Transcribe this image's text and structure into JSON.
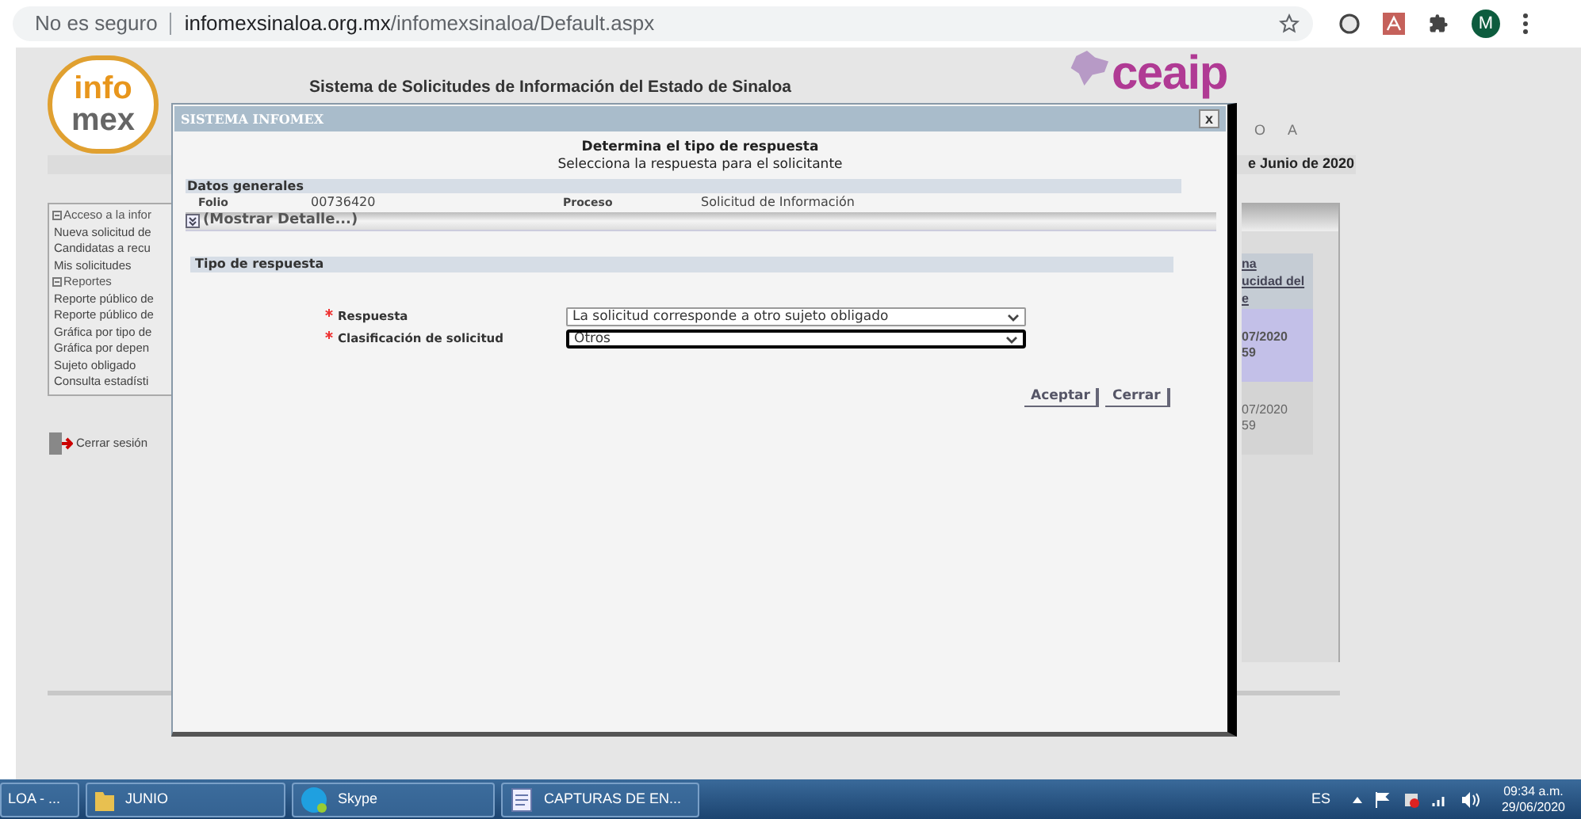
{
  "browser": {
    "security": "No es seguro",
    "url_host": "infomexsinaloa.org.mx",
    "url_path": "/infomexsinaloa/Default.aspx",
    "profile_initial": "M"
  },
  "page": {
    "logo_top": "info",
    "logo_bottom": "mex",
    "title": "Sistema de Solicitudes de Información del Estado de Sinaloa",
    "partner_logo": "ceaip",
    "partner_logo_subtitle": "O A",
    "date": "e Junio de 2020",
    "menu": [
      {
        "kind": "group",
        "label": "Acceso a la infor"
      },
      {
        "kind": "link",
        "label": "Nueva solicitud de"
      },
      {
        "kind": "link",
        "label": "Candidatas a recu"
      },
      {
        "kind": "link",
        "label": "Mis solicitudes"
      },
      {
        "kind": "group",
        "label": "Reportes"
      },
      {
        "kind": "link",
        "label": "Reporte público de"
      },
      {
        "kind": "link",
        "label": "Reporte público de"
      },
      {
        "kind": "link",
        "label": "Gráfica por tipo de"
      },
      {
        "kind": "link",
        "label": "Gráfica por depen"
      },
      {
        "kind": "link",
        "label": "Sujeto obligado"
      },
      {
        "kind": "link",
        "label": "Consulta estadísti"
      }
    ],
    "logout": "Cerrar sesión",
    "table_header": [
      "na",
      "ucidad del",
      "e"
    ],
    "rows": [
      {
        "lines": [
          "07/2020",
          "59"
        ],
        "selected": true
      },
      {
        "lines": [
          "07/2020",
          "59"
        ],
        "selected": false
      }
    ]
  },
  "dialog": {
    "title": "SISTEMA INFOMEX",
    "close": "x",
    "heading": "Determina el tipo de respuesta",
    "subheading": "Selecciona la respuesta para el solicitante",
    "general_section": "Datos generales",
    "folio_label": "Folio",
    "folio": "00736420",
    "process_label": "Proceso",
    "process": "Solicitud de Información",
    "details_toggle": "(Mostrar Detalle...)",
    "response_section": "Tipo de respuesta",
    "fields": [
      {
        "label": "Respuesta",
        "required": true,
        "value": "La solicitud corresponde a otro sujeto obligado",
        "focused": false
      },
      {
        "label": "Clasificación de solicitud",
        "required": true,
        "value": "Otros",
        "focused": true
      }
    ],
    "buttons": [
      "Aceptar",
      "Cerrar"
    ]
  },
  "taskbar": {
    "items": [
      {
        "kind": "window",
        "label": "LOA - ..."
      },
      {
        "kind": "folder",
        "label": "JUNIO"
      },
      {
        "kind": "skype",
        "label": "Skype"
      },
      {
        "kind": "document",
        "label": "CAPTURAS DE EN..."
      }
    ],
    "language": "ES",
    "time": "09:34 a.m.",
    "date": "29/06/2020"
  }
}
